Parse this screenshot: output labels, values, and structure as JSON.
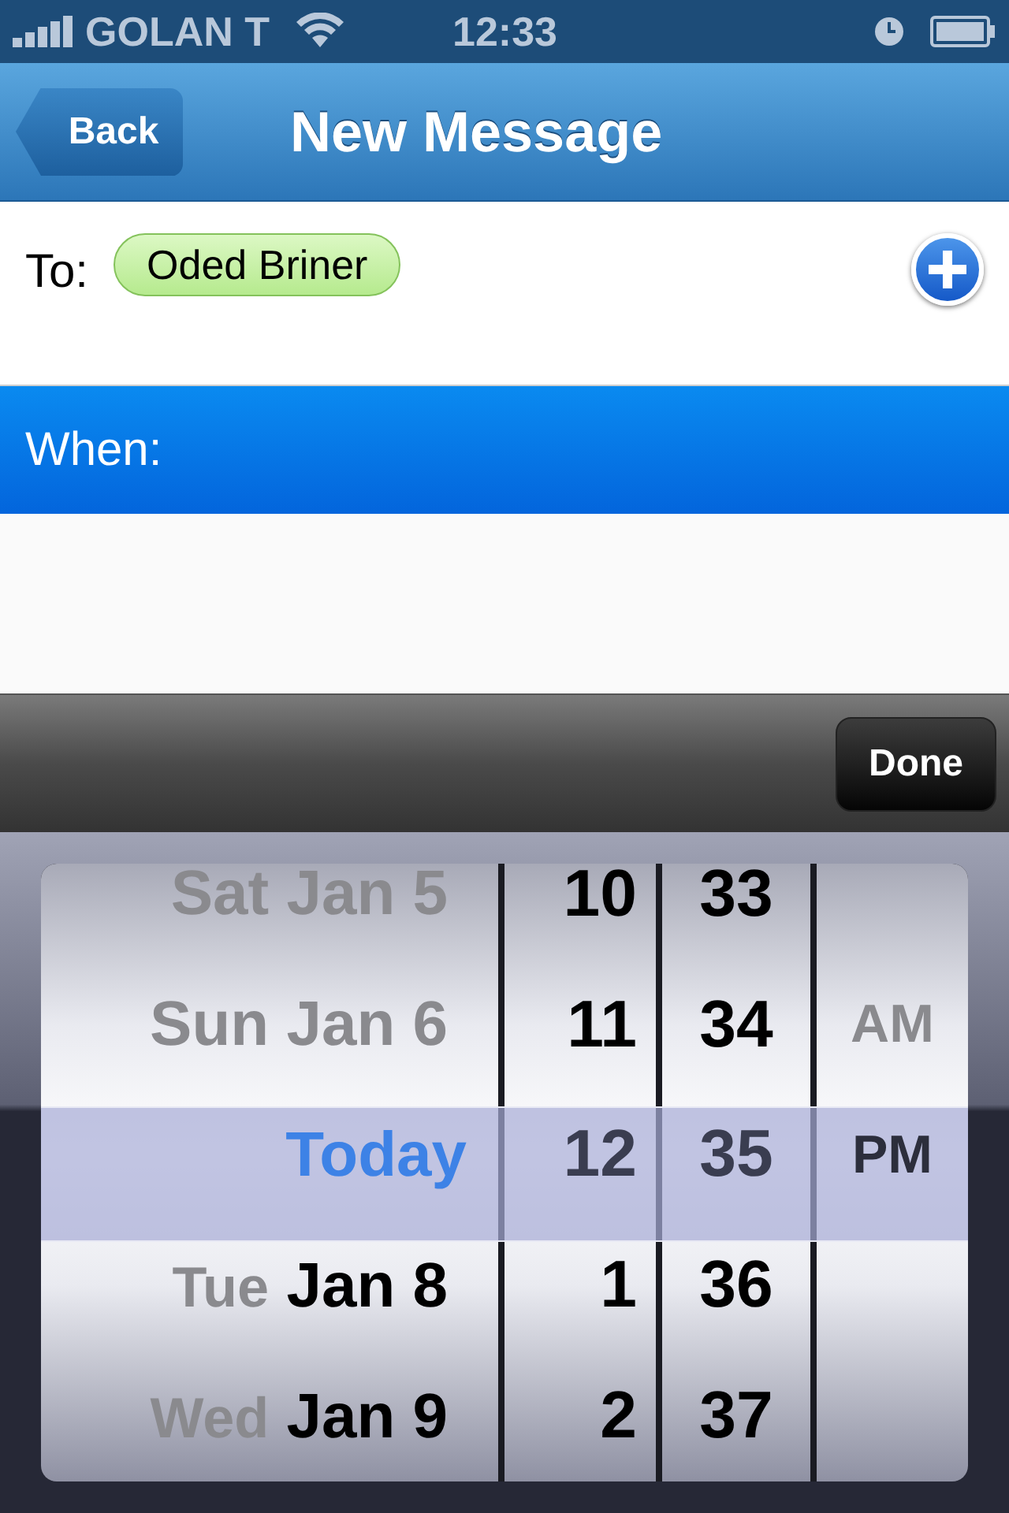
{
  "status_bar": {
    "carrier": "GOLAN T",
    "time": "12:33"
  },
  "nav_bar": {
    "back_button": "Back",
    "title": "New Message"
  },
  "recipient": {
    "label": "To:",
    "chips": [
      "Oded Briner"
    ]
  },
  "when": {
    "label": "When:",
    "selected": true
  },
  "toolbar": {
    "done_button": "Done"
  },
  "picker": {
    "date_wheel": [
      {
        "kind": "past",
        "text": "Sat Jan 5",
        "selected": false
      },
      {
        "kind": "past",
        "text": "Sun Jan 6",
        "selected": false
      },
      {
        "kind": "today",
        "text": "Today",
        "selected": true
      },
      {
        "kind": "future",
        "weekday": "Tue",
        "date": "Jan 8",
        "selected": false
      },
      {
        "kind": "future",
        "weekday": "Wed",
        "date": "Jan 9",
        "selected": false
      }
    ],
    "hour_wheel": [
      {
        "text": "10",
        "selected": false
      },
      {
        "text": "11",
        "selected": false
      },
      {
        "text": "12",
        "selected": true
      },
      {
        "text": "1",
        "selected": false
      },
      {
        "text": "2",
        "selected": false
      }
    ],
    "minute_wheel": [
      {
        "text": "33",
        "selected": false
      },
      {
        "text": "34",
        "selected": false
      },
      {
        "text": "35",
        "selected": true
      },
      {
        "text": "36",
        "selected": false
      },
      {
        "text": "37",
        "selected": false
      }
    ],
    "period_wheel": [
      {
        "text": "AM",
        "selected": false
      },
      {
        "text": "PM",
        "selected": true
      }
    ]
  }
}
